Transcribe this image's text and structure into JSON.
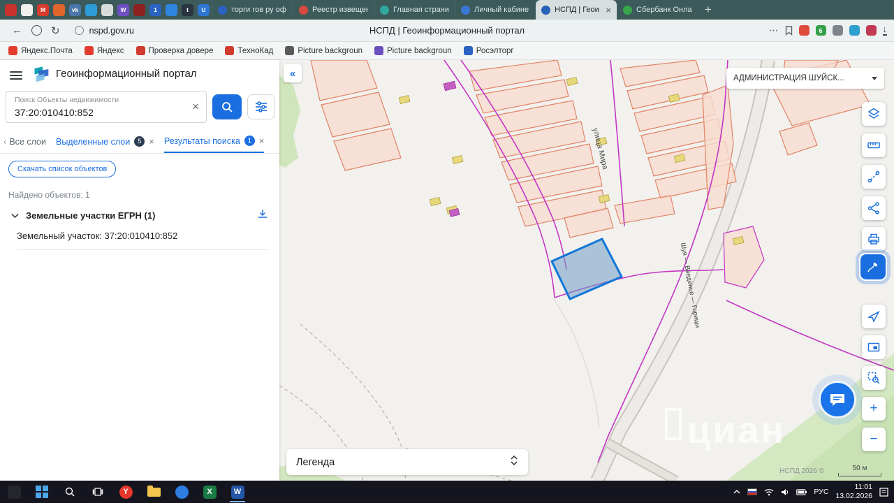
{
  "colors": {
    "accent_blue": "#1a6ee0",
    "selected_parcel_stroke": "#1276d8",
    "parcel_stroke": "#e08467",
    "parcel_fill": "#f8dccf",
    "boundary_magenta": "#c435c4",
    "tabbar_bg": "#3c5a5a",
    "taskbar_bg": "#15151f"
  },
  "browser": {
    "pinned_tabs": [
      {
        "color": "#c9322b",
        "glyph": ""
      },
      {
        "color": "#f0f0ee",
        "glyph": ""
      },
      {
        "color": "#d93a2e",
        "glyph": "M"
      },
      {
        "color": "#e0662c",
        "glyph": ""
      },
      {
        "color": "#4a76a8",
        "glyph": "vk"
      },
      {
        "color": "#2d9bd6",
        "glyph": ""
      },
      {
        "color": "#d8dcdc",
        "glyph": ""
      },
      {
        "color": "#6e4fc1",
        "glyph": "W"
      },
      {
        "color": "#8d2020",
        "glyph": ""
      },
      {
        "color": "#2b63c4",
        "glyph": "1"
      },
      {
        "color": "#2e86de",
        "glyph": ""
      },
      {
        "color": "#2a3340",
        "glyph": "t"
      },
      {
        "color": "#2f76d2",
        "glyph": "U"
      }
    ],
    "tabs": [
      {
        "title": "торги гов ру оф",
        "favicon_color": "#2b63c4"
      },
      {
        "title": "Реестр извещен",
        "favicon_color": "#d64b3f"
      },
      {
        "title": "Главная страни",
        "favicon_color": "#2fa8a0"
      },
      {
        "title": "Личный кабине",
        "favicon_color": "#3b78d6"
      },
      {
        "title": "НСПД | Геои",
        "favicon_color": "#2660b8"
      },
      {
        "title": "Сбербанк Онла",
        "favicon_color": "#38a84b"
      }
    ],
    "new_tab_glyph": "+",
    "close_glyph": "×",
    "back_glyph": "←",
    "reload_glyph": "↻",
    "menu_glyph": "⋯",
    "download_glyph": "↓",
    "url": "nspd.gov.ru",
    "page_title": "НСПД | Геоинформационный портал",
    "extensions": [
      {
        "color": "#e04c3c",
        "glyph": ""
      },
      {
        "color": "#35a04a",
        "glyph": "6"
      },
      {
        "color": "#7e858a",
        "glyph": ""
      },
      {
        "color": "#2f9fd0",
        "glyph": ""
      },
      {
        "color": "#c23b52",
        "glyph": ""
      }
    ],
    "bookmarks": [
      {
        "label": "Яндекс.Почта",
        "color": "#e23c2e"
      },
      {
        "label": "Яндекс",
        "color": "#e23c2e"
      },
      {
        "label": "Проверка довере",
        "color": "#d03b2f"
      },
      {
        "label": "ТехноКад",
        "color": "#d03b2f"
      },
      {
        "label": "Picture backgroun",
        "color": "#5a5a5a"
      },
      {
        "label": "Picture backgroun",
        "color": "#6a4fc0"
      },
      {
        "label": "Росэлторг",
        "color": "#2b63c4"
      }
    ]
  },
  "panel": {
    "title": "Геоинформационный портал",
    "search": {
      "label": "Поиск Объекты недвижимости",
      "value": "37:20:010410:852",
      "clear_glyph": "×"
    },
    "scroll_glyph": "‹",
    "tabs": [
      {
        "label": "Все слои",
        "badge": ""
      },
      {
        "label": "Выделенные слои",
        "badge": "5"
      },
      {
        "label": "Результаты поиска",
        "badge": "1"
      }
    ],
    "close_glyph": "×",
    "download_button": "Скачать список объектов",
    "found_text": "Найдено объектов: 1",
    "group_title": "Земельные участки ЕГРН (1)",
    "item_text": "Земельный участок: 37:20:010410:852"
  },
  "map": {
    "collapse_glyph": "«",
    "region_selector": "АДМИНИСТРАЦИЯ ШУЙСК...",
    "legend_label": "Легенда",
    "street_label_1": "улица Мира",
    "street_label_2": "Шуя — Введенье — Горицы",
    "watermark": "циан",
    "attribution": "НСПД 2026 ©",
    "scale_label": "50 м",
    "zoom_in_glyph": "+",
    "zoom_out_glyph": "−"
  },
  "taskbar": {
    "lang": "РУС",
    "time": "11:01",
    "date": "13.02.2026"
  }
}
